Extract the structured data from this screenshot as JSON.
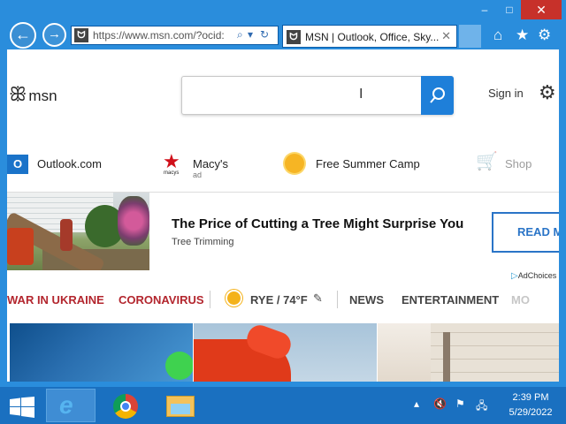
{
  "browser": {
    "window_controls": {
      "minimize": "‒",
      "maximize": "□",
      "close": "✕"
    },
    "address_bar": {
      "favicon": "msn-favicon",
      "url": "https://www.msn.com/?ocid:",
      "search_icon": "⌕",
      "dropdown_icon": "▾",
      "refresh_icon": "↻"
    },
    "tab": {
      "favicon": "msn-favicon",
      "title": "MSN | Outlook, Office, Sky...",
      "close": "✕"
    },
    "toolbar_icons": {
      "home": "⌂",
      "favorites": "★",
      "settings": "⚙"
    }
  },
  "page": {
    "logo_text": "msn",
    "search": {
      "placeholder": ""
    },
    "sign_in": "Sign in",
    "quick_links": [
      {
        "label": "Outlook.com",
        "icon": "outlook-icon"
      },
      {
        "label": "Macy's",
        "sub": "ad",
        "icon": "macys-star-icon",
        "icon_sub": "macys"
      },
      {
        "label": "Free Summer Camp",
        "icon": "sun-icon"
      },
      {
        "label": "Shop",
        "icon": "shopping-cart-icon"
      }
    ],
    "ad": {
      "title": "The Price of Cutting a Tree Might Surprise You",
      "subtitle": "Tree Trimming",
      "button": "READ M",
      "adchoices": "AdChoices"
    },
    "categories": [
      {
        "label": "WAR IN UKRAINE",
        "color": "#b3262e"
      },
      {
        "label": "CORONAVIRUS",
        "color": "#b3262e"
      },
      {
        "label": "RYE / 74°F",
        "color": "#444444"
      },
      {
        "label": "NEWS",
        "color": "#444444"
      },
      {
        "label": "ENTERTAINMENT",
        "color": "#444444"
      },
      {
        "label": "MO",
        "color": "#444444"
      }
    ]
  },
  "taskbar": {
    "apps": [
      "start",
      "internet-explorer",
      "chrome",
      "file-explorer"
    ],
    "tray_icons": [
      "chevron-up-icon",
      "speaker-muted-icon",
      "flag-icon",
      "network-icon"
    ],
    "time": "2:39 PM",
    "date": "5/29/2022"
  },
  "colors": {
    "accent": "#1e7fd9",
    "titlebar": "#2a8ddc",
    "taskbar": "#1a70c0",
    "headline_red": "#b3262e"
  }
}
